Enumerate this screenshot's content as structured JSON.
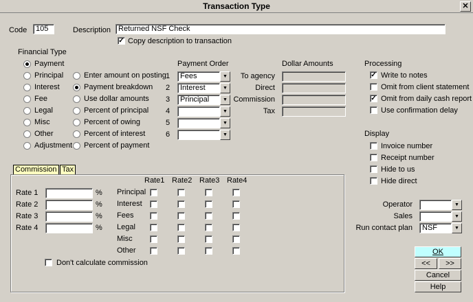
{
  "window": {
    "title": "Transaction Type",
    "close": "✕"
  },
  "code": {
    "label": "Code",
    "value": "105"
  },
  "description": {
    "label": "Description",
    "value": "Returned NSF Check"
  },
  "copy_description": {
    "label": "Copy description to transaction",
    "checked": true
  },
  "financial_type": {
    "label": "Financial Type",
    "col1": [
      {
        "label": "Payment",
        "selected": true
      },
      {
        "label": "Principal",
        "selected": false
      },
      {
        "label": "Interest",
        "selected": false
      },
      {
        "label": "Fee",
        "selected": false
      },
      {
        "label": "Legal",
        "selected": false
      },
      {
        "label": "Misc",
        "selected": false
      },
      {
        "label": "Other",
        "selected": false
      },
      {
        "label": "Adjustment",
        "selected": false
      }
    ],
    "col2": [
      {
        "label": "Enter amount on posting",
        "selected": false
      },
      {
        "label": "Payment breakdown",
        "selected": true
      },
      {
        "label": "Use dollar amounts",
        "selected": false
      },
      {
        "label": "Percent of principal",
        "selected": false
      },
      {
        "label": "Percent of owing",
        "selected": false
      },
      {
        "label": "Percent of interest",
        "selected": false
      },
      {
        "label": "Percent of payment",
        "selected": false
      }
    ]
  },
  "payment_order": {
    "label": "Payment Order",
    "rows": [
      {
        "num": "1",
        "value": "Fees"
      },
      {
        "num": "2",
        "value": "Interest"
      },
      {
        "num": "3",
        "value": "Principal"
      },
      {
        "num": "4",
        "value": ""
      },
      {
        "num": "5",
        "value": ""
      },
      {
        "num": "6",
        "value": ""
      }
    ]
  },
  "dollar_amounts": {
    "label": "Dollar Amounts",
    "rows": [
      {
        "label": "To agency",
        "value": ""
      },
      {
        "label": "Direct",
        "value": ""
      },
      {
        "label": "Commission",
        "value": ""
      },
      {
        "label": "Tax",
        "value": ""
      }
    ]
  },
  "processing": {
    "label": "Processing",
    "items": [
      {
        "label": "Write to notes",
        "checked": true
      },
      {
        "label": "Omit from client statement",
        "checked": false
      },
      {
        "label": "Omit from daily cash report",
        "checked": true
      },
      {
        "label": "Use confirmation delay",
        "checked": false
      }
    ]
  },
  "display": {
    "label": "Display",
    "items": [
      {
        "label": "Invoice number",
        "checked": false
      },
      {
        "label": "Receipt number",
        "checked": false
      },
      {
        "label": "Hide to us",
        "checked": false
      },
      {
        "label": "Hide direct",
        "checked": false
      }
    ]
  },
  "tabs": [
    {
      "label": "Commission",
      "active": true
    },
    {
      "label": "Tax",
      "active": false
    }
  ],
  "commission": {
    "rates": [
      {
        "label": "Rate 1",
        "value": "",
        "unit": "%"
      },
      {
        "label": "Rate 2",
        "value": "",
        "unit": "%"
      },
      {
        "label": "Rate 3",
        "value": "",
        "unit": "%"
      },
      {
        "label": "Rate 4",
        "value": "",
        "unit": "%"
      }
    ],
    "columns": [
      "Rate1",
      "Rate2",
      "Rate3",
      "Rate4"
    ],
    "categories": [
      "Principal",
      "Interest",
      "Fees",
      "Legal",
      "Misc",
      "Other"
    ],
    "dont_calc": {
      "label": "Don't calculate commission",
      "checked": false
    }
  },
  "right_fields": [
    {
      "label": "Operator",
      "value": ""
    },
    {
      "label": "Sales",
      "value": ""
    },
    {
      "label": "Run contact plan",
      "value": "NSF"
    }
  ],
  "buttons": {
    "ok": "OK",
    "prev": "<<",
    "next": ">>",
    "cancel": "Cancel",
    "help": "Help"
  },
  "icons": {
    "dropdown": "▼",
    "check": "✓"
  }
}
